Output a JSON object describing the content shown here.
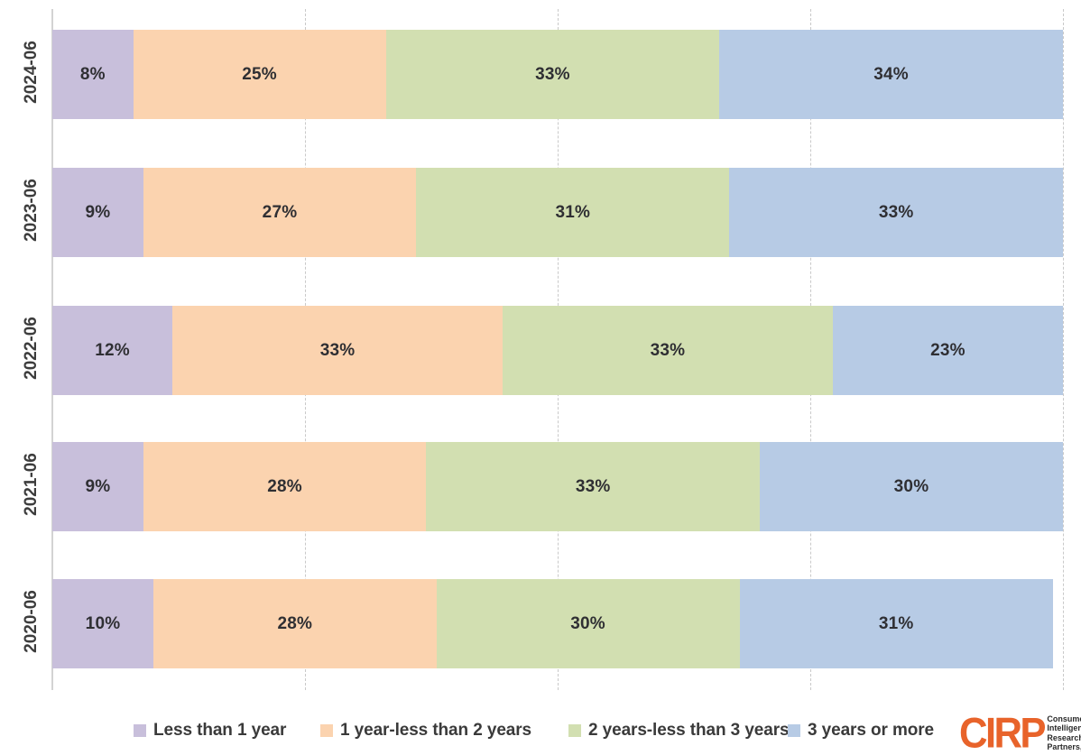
{
  "chart_data": {
    "type": "bar",
    "subtype": "horizontal stacked bar (100%)",
    "title": "",
    "subtitle": "",
    "xlabel": "",
    "ylabel": "",
    "xlim": [
      0,
      100
    ],
    "ylim": null,
    "grid": true,
    "grid_axis": "x",
    "gridline_values": [
      25,
      50,
      75,
      100
    ],
    "legend_position": "bottom",
    "orientation": "horizontal",
    "stacked": true,
    "categories": [
      "2024-06",
      "2023-06",
      "2022-06",
      "2021-06",
      "2020-06"
    ],
    "series": [
      {
        "name": "Less than 1 year",
        "color": "#c8bfdb",
        "values": [
          8,
          9,
          12,
          9,
          10
        ],
        "labels": [
          "8%",
          "9%",
          "12%",
          "9%",
          "10%"
        ]
      },
      {
        "name": "1 year-less than 2 years",
        "color": "#fbd3af",
        "values": [
          25,
          27,
          33,
          28,
          28
        ],
        "labels": [
          "25%",
          "27%",
          "33%",
          "28%",
          "28%"
        ]
      },
      {
        "name": "2 years-less than 3 years",
        "color": "#d2dfb1",
        "values": [
          33,
          31,
          33,
          33,
          30
        ],
        "labels": [
          "33%",
          "31%",
          "33%",
          "33%",
          "30%"
        ]
      },
      {
        "name": "3 years or more",
        "color": "#b7cbe5",
        "values": [
          34,
          33,
          23,
          30,
          31
        ],
        "labels": [
          "34%",
          "33%",
          "23%",
          "30%",
          "31%"
        ]
      }
    ]
  },
  "axis": {
    "y_tick_labels": [
      "2024-06",
      "2023-06",
      "2022-06",
      "2021-06",
      "2020-06"
    ]
  },
  "legend": {
    "items": [
      {
        "label": "Less than 1 year",
        "color": "#c8bfdb"
      },
      {
        "label": "1 year-less than 2 years",
        "color": "#fbd3af"
      },
      {
        "label": "2 years-less than 3 years",
        "color": "#d2dfb1"
      },
      {
        "label": "3 years or more",
        "color": "#b7cbe5"
      }
    ]
  },
  "branding": {
    "wordmark": "CIRP",
    "wordmark_color": "#e8632a",
    "tagline_lines": [
      "Consumer",
      "Intelligence",
      "Research",
      "Partners, LLC"
    ]
  },
  "colors": {
    "background": "#ffffff",
    "gridline": "#c9c9c9",
    "axis_line": "#d3d3d3",
    "label_text": "#2f2f33",
    "tick_text": "#3d3d3d"
  }
}
